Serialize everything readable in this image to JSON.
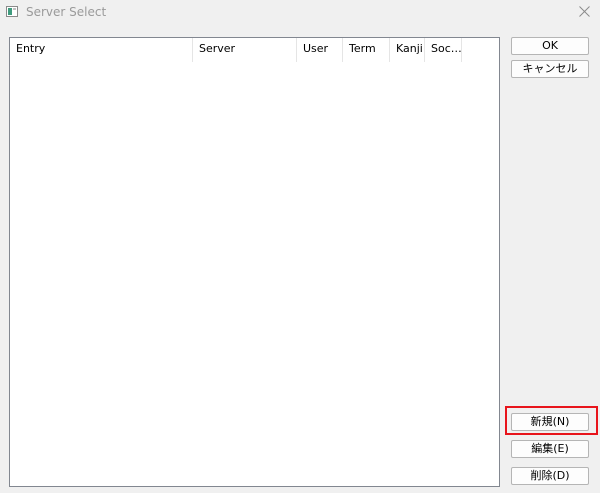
{
  "window": {
    "title": "Server Select",
    "icon": "app-window-icon",
    "close_icon": "close-icon"
  },
  "list": {
    "columns": [
      "Entry",
      "Server",
      "User",
      "Term",
      "Kanji",
      "Soc…"
    ],
    "rows": []
  },
  "buttons": {
    "ok": "OK",
    "cancel": "キャンセル",
    "new": "新規(N)",
    "edit": "編集(E)",
    "delete": "削除(D)"
  },
  "colors": {
    "highlight": "#e8141b",
    "background": "#f0f0f0"
  }
}
